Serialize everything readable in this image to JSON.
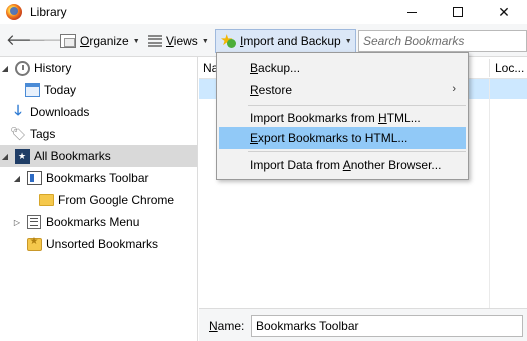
{
  "window": {
    "title": "Library"
  },
  "toolbar": {
    "organize_prefix": "",
    "organize_underline": "O",
    "organize_rest": "rganize",
    "views_underline": "V",
    "views_rest": "iews",
    "import_underline": "I",
    "import_rest": "mport and Backup",
    "search_placeholder": "Search Bookmarks"
  },
  "sidebar": {
    "items": [
      {
        "label": "History",
        "icon": "clock-icon"
      },
      {
        "label": "Today",
        "icon": "calendar-icon"
      },
      {
        "label": "Downloads",
        "icon": "download-icon"
      },
      {
        "label": "Tags",
        "icon": "tag-icon"
      },
      {
        "label": "All Bookmarks",
        "icon": "all-bookmarks-icon"
      },
      {
        "label": "Bookmarks Toolbar",
        "icon": "bookmarks-toolbar-icon"
      },
      {
        "label": "From Google Chrome",
        "icon": "folder-icon"
      },
      {
        "label": "Bookmarks Menu",
        "icon": "bookmarks-menu-icon"
      },
      {
        "label": "Unsorted Bookmarks",
        "icon": "unsorted-bookmarks-icon"
      }
    ]
  },
  "list": {
    "columns": [
      "Na",
      "Loc..."
    ]
  },
  "details": {
    "name_label_underline": "N",
    "name_label_rest": "ame:",
    "name_value": "Bookmarks Toolbar"
  },
  "menu": {
    "items": [
      {
        "underline": "B",
        "rest": "ackup..."
      },
      {
        "underline": "R",
        "rest": "estore",
        "submenu_arrow": "›"
      },
      {
        "pre": "Import Bookmarks from ",
        "underline": "H",
        "rest": "TML..."
      },
      {
        "underline": "E",
        "rest": "xport Bookmarks to HTML..."
      },
      {
        "pre": "Import Data from ",
        "underline": "A",
        "rest": "nother Browser..."
      }
    ]
  }
}
